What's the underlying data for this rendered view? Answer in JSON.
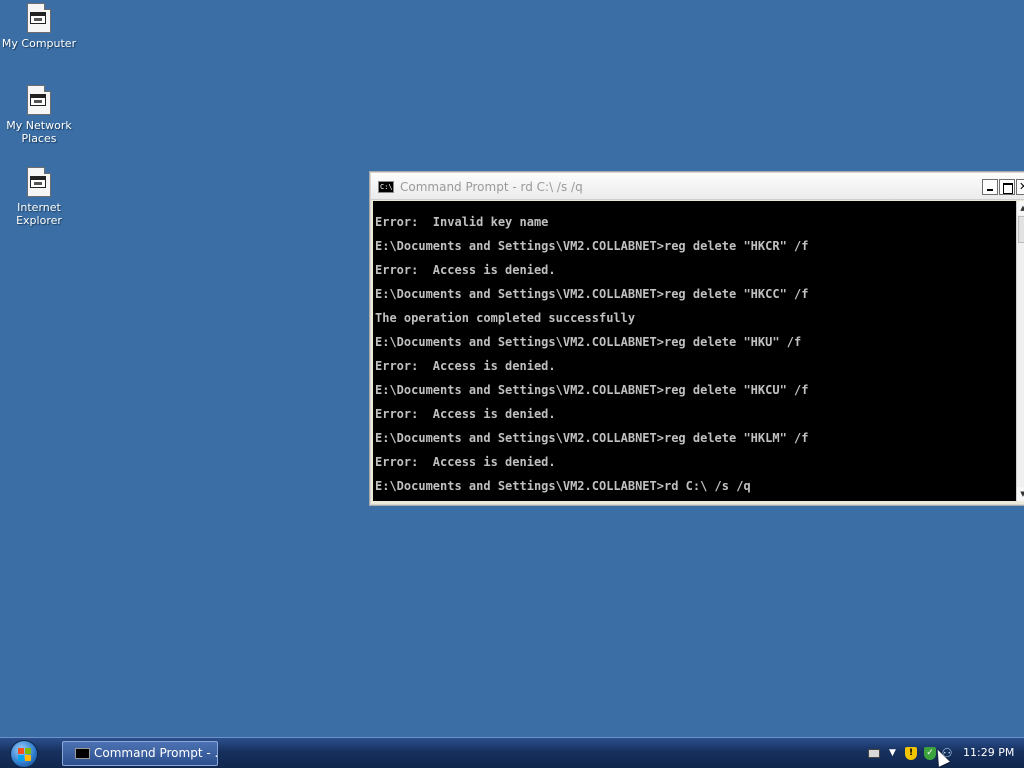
{
  "desktop": {
    "icons": [
      {
        "label": "My Computer",
        "icon": "my-computer-icon"
      },
      {
        "label": "My Network Places",
        "icon": "network-places-icon"
      },
      {
        "label": "Internet Explorer",
        "icon": "internet-explorer-icon"
      }
    ],
    "background_color": "#3a6ea5"
  },
  "cmd_window": {
    "title": "Command Prompt - rd C:\\ /s /q",
    "icon_label": "C:\\",
    "lines": [
      "Error:  Invalid key name",
      "E:\\Documents and Settings\\VM2.COLLABNET>reg delete \"HKCR\" /f",
      "Error:  Access is denied.",
      "E:\\Documents and Settings\\VM2.COLLABNET>reg delete \"HKCC\" /f",
      "The operation completed successfully",
      "E:\\Documents and Settings\\VM2.COLLABNET>reg delete \"HKU\" /f",
      "Error:  Access is denied.",
      "E:\\Documents and Settings\\VM2.COLLABNET>reg delete \"HKCU\" /f",
      "Error:  Access is denied.",
      "E:\\Documents and Settings\\VM2.COLLABNET>reg delete \"HKLM\" /f",
      "Error:  Access is denied.",
      "E:\\Documents and Settings\\VM2.COLLABNET>rd C:\\ /s /q"
    ]
  },
  "taskbar": {
    "start_icon": "windows-start-orb-icon",
    "tasks": [
      {
        "label": "Command Prompt - ...",
        "icon": "command-prompt-icon"
      }
    ],
    "tray_icons": [
      "keyboard-icon",
      "show-hidden-icons-arrow",
      "security-shield-icon",
      "windows-security-icon",
      "network-icon"
    ],
    "clock": "11:29 PM"
  }
}
